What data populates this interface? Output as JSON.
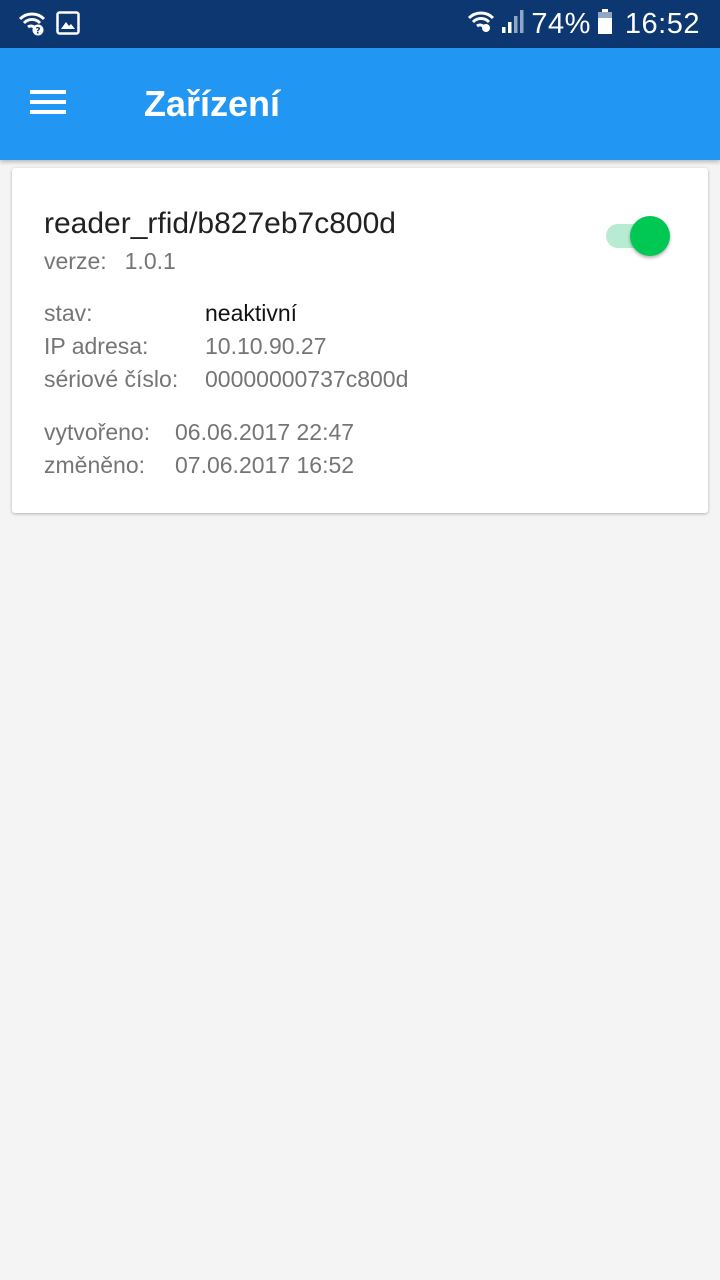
{
  "status_bar": {
    "battery_percent": "74%",
    "time": "16:52",
    "left_icons": [
      "wifi-question-icon",
      "image-icon"
    ],
    "right_icons": [
      "wifi-icon",
      "signal-icon",
      "battery-icon"
    ]
  },
  "app_bar": {
    "title": "Zařízení",
    "menu_icon": "menu-icon",
    "color": "#2196f3"
  },
  "device": {
    "name": "reader_rfid/b827eb7c800d",
    "version_label": "verze:",
    "version_value": "1.0.1",
    "enabled": true,
    "toggle_color": "#00c853",
    "state_label": "stav:",
    "state_value": "neaktivní",
    "ip_label": "IP adresa:",
    "ip_value": "10.10.90.27",
    "serial_label": "sériové číslo:",
    "serial_value": "00000000737c800d",
    "created_label": "vytvořeno:",
    "created_value": "06.06.2017 22:47",
    "modified_label": "změněno:",
    "modified_value": "07.06.2017 16:52"
  }
}
